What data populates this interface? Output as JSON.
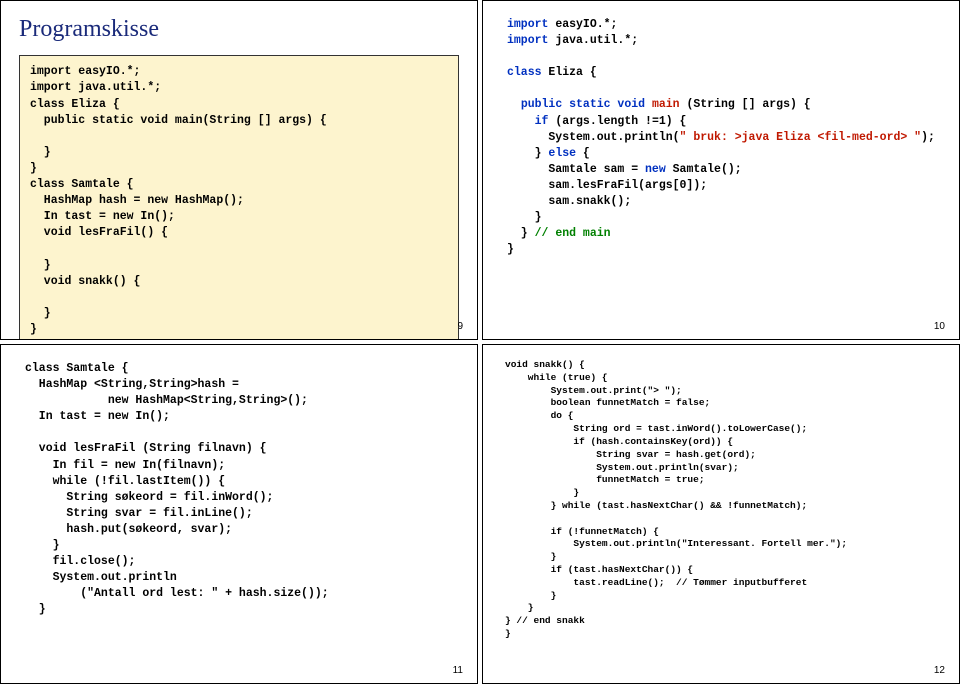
{
  "slide9": {
    "title": "Programskisse",
    "pagenum": "9",
    "code": "import easyIO.*;\nimport java.util.*;\nclass Eliza {\n  public static void main(String [] args) {\n\n  }\n}\nclass Samtale {\n  HashMap hash = new HashMap();\n  In tast = new In();\n  void lesFraFil() {\n\n  }\n  void snakk() {\n\n  }\n}"
  },
  "slide10": {
    "pagenum": "10",
    "code_segments": [
      {
        "t": "import",
        "cls": "kw-blue"
      },
      {
        "t": " easyIO.*;\n"
      },
      {
        "t": "import",
        "cls": "kw-blue"
      },
      {
        "t": " java.util.*;\n\n"
      },
      {
        "t": "class",
        "cls": "kw-blue"
      },
      {
        "t": " Eliza {\n\n  "
      },
      {
        "t": "public static void",
        "cls": "kw-blue"
      },
      {
        "t": " "
      },
      {
        "t": "main",
        "cls": "kw-red"
      },
      {
        "t": " (String [] args) {\n    "
      },
      {
        "t": "if",
        "cls": "kw-blue"
      },
      {
        "t": " (args.length !=1) {\n      System.out.println("
      },
      {
        "t": "\" bruk: >java Eliza <fil-med-ord> \"",
        "cls": "str-red"
      },
      {
        "t": ");\n    } "
      },
      {
        "t": "else",
        "cls": "kw-blue"
      },
      {
        "t": " {\n      Samtale sam = "
      },
      {
        "t": "new",
        "cls": "kw-blue"
      },
      {
        "t": " Samtale();\n      sam.lesFraFil(args[0]);\n      sam.snakk();\n    }\n  } "
      },
      {
        "t": "// end main",
        "cls": "cm-grn"
      },
      {
        "t": "\n}\n"
      }
    ]
  },
  "slide11": {
    "pagenum": "11",
    "code": "class Samtale {\n  HashMap <String,String>hash =\n            new HashMap<String,String>();\n  In tast = new In();\n\n  void lesFraFil (String filnavn) {\n    In fil = new In(filnavn);\n    while (!fil.lastItem()) {\n      String søkeord = fil.inWord();\n      String svar = fil.inLine();\n      hash.put(søkeord, svar);\n    }\n    fil.close();\n    System.out.println\n        (\"Antall ord lest: \" + hash.size());\n  }"
  },
  "slide12": {
    "pagenum": "12",
    "code": "void snakk() {\n    while (true) {\n        System.out.print(\"> \");\n        boolean funnetMatch = false;\n        do {\n            String ord = tast.inWord().toLowerCase();\n            if (hash.containsKey(ord)) {\n                String svar = hash.get(ord);\n                System.out.println(svar);\n                funnetMatch = true;\n            }\n        } while (tast.hasNextChar() && !funnetMatch);\n\n        if (!funnetMatch) {\n            System.out.println(\"Interessant. Fortell mer.\");\n        }\n        if (tast.hasNextChar()) {\n            tast.readLine();  // Tømmer inputbufferet\n        }\n    }\n} // end snakk\n}"
  }
}
